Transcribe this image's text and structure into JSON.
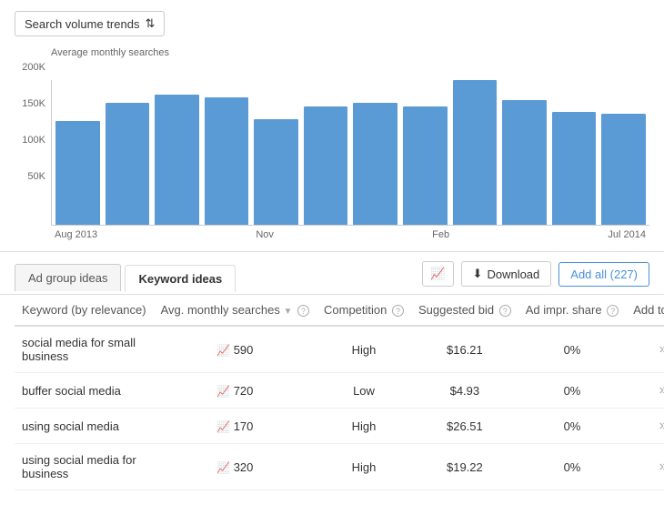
{
  "chart": {
    "dropdown_label": "Search volume trends",
    "dropdown_arrow": "⇅",
    "y_axis_label": "Average monthly searches",
    "y_ticks": [
      "200K",
      "150K",
      "100K",
      "50K",
      ""
    ],
    "bars": [
      {
        "label": "Aug 2013",
        "height_pct": 72
      },
      {
        "label": "",
        "height_pct": 84
      },
      {
        "label": "",
        "height_pct": 90
      },
      {
        "label": "Nov",
        "height_pct": 88
      },
      {
        "label": "",
        "height_pct": 73
      },
      {
        "label": "",
        "height_pct": 82
      },
      {
        "label": "Feb",
        "height_pct": 84
      },
      {
        "label": "",
        "height_pct": 82
      },
      {
        "label": "",
        "height_pct": 100
      },
      {
        "label": "",
        "height_pct": 86
      },
      {
        "label": "",
        "height_pct": 78
      },
      {
        "label": "Jul 2014",
        "height_pct": 77
      }
    ],
    "x_labels": [
      "Aug 2013",
      "Nov",
      "Feb",
      "Jul 2014"
    ]
  },
  "tabs": {
    "tab1_label": "Ad group ideas",
    "tab2_label": "Keyword ideas"
  },
  "toolbar": {
    "trend_icon": "📈",
    "download_icon": "⬇",
    "download_label": "Download",
    "add_all_label": "Add all (227)"
  },
  "table": {
    "col_keyword": "Keyword (by relevance)",
    "col_monthly": "Avg. monthly searches",
    "col_competition": "Competition",
    "col_bid": "Suggested bid",
    "col_impr": "Ad impr. share",
    "col_add": "Add to plan",
    "help": "?",
    "rows": [
      {
        "keyword": "social media for small business",
        "monthly": "590",
        "competition": "High",
        "bid": "$16.21",
        "impr": "0%"
      },
      {
        "keyword": "buffer social media",
        "monthly": "720",
        "competition": "Low",
        "bid": "$4.93",
        "impr": "0%"
      },
      {
        "keyword": "using social media",
        "monthly": "170",
        "competition": "High",
        "bid": "$26.51",
        "impr": "0%"
      },
      {
        "keyword": "using social media for business",
        "monthly": "320",
        "competition": "High",
        "bid": "$19.22",
        "impr": "0%"
      }
    ]
  }
}
